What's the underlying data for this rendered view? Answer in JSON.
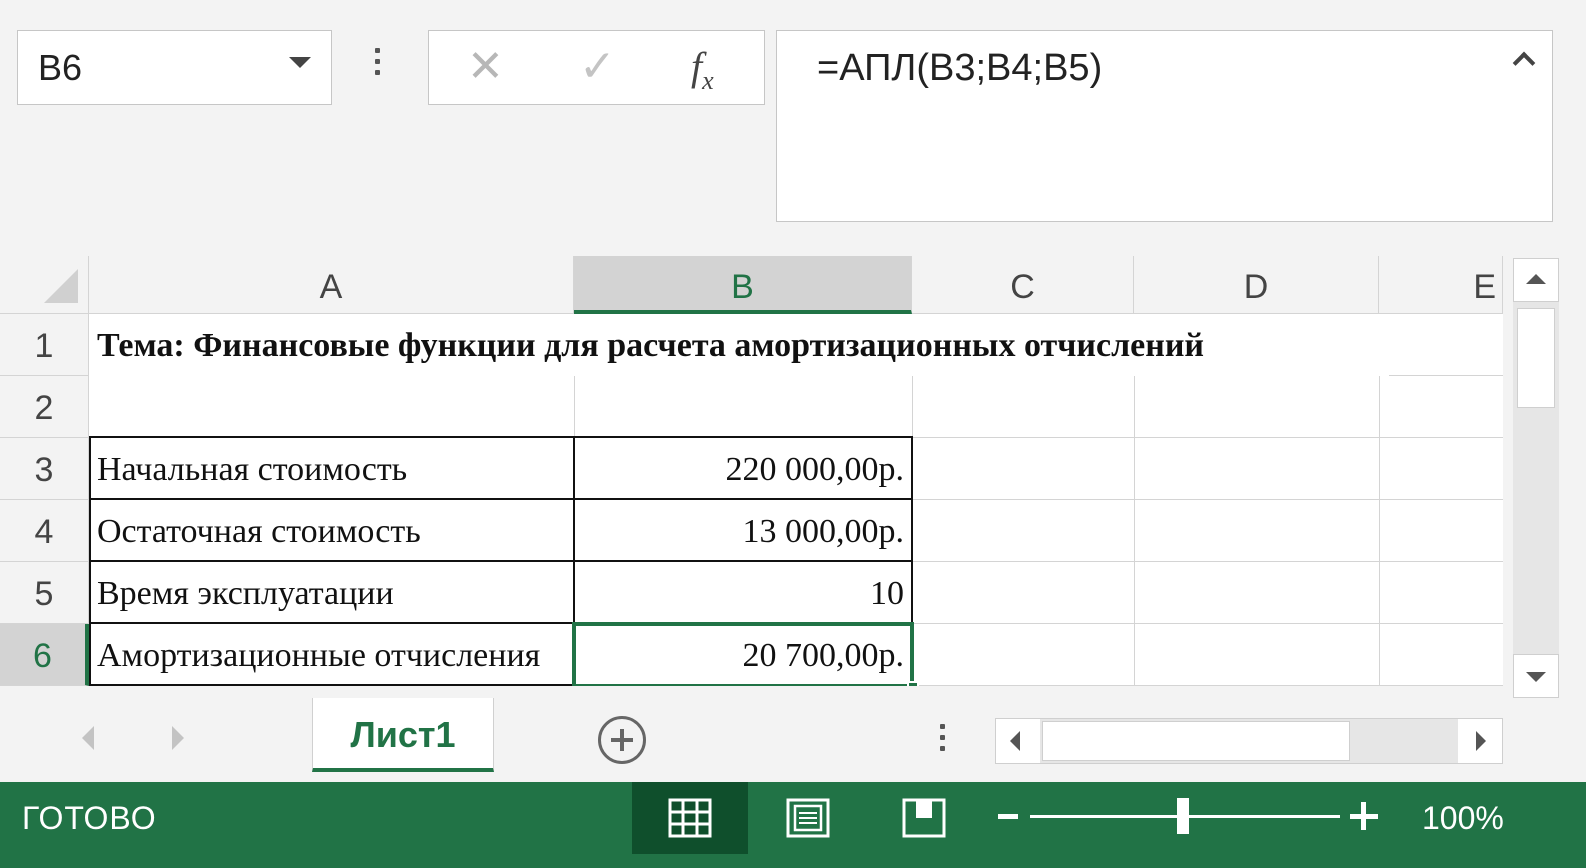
{
  "formula_bar": {
    "name_box": "B6",
    "cancel_glyph": "✕",
    "enter_glyph": "✓",
    "fx_label": "f",
    "fx_sub": "x",
    "formula": "=АПЛ(B3;B4;B5)"
  },
  "grid": {
    "columns": [
      "A",
      "B",
      "C",
      "D",
      "E"
    ],
    "selected_column": "B",
    "rows": [
      "1",
      "2",
      "3",
      "4",
      "5",
      "6"
    ],
    "selected_row": "6",
    "cells": {
      "A1": "Тема: Финансовые функции для расчета амортизационных отчислений",
      "A3": "Начальная стоимость",
      "B3": "220 000,00р.",
      "A4": "Остаточная стоимость",
      "B4": "13 000,00р.",
      "A5": "Время эксплуатации",
      "B5": "10",
      "A6": "Амортизационные отчисления",
      "B6": "20 700,00р."
    }
  },
  "sheet_tabs": {
    "active": "Лист1"
  },
  "status_bar": {
    "status": "ГОТОВО",
    "zoom": "100%"
  },
  "colors": {
    "accent": "#217346",
    "accent_dark": "#0f4f2c"
  },
  "icons": [
    "chevron-down-icon",
    "more-vertical-icon",
    "cancel-icon",
    "enter-icon",
    "function-icon",
    "collapse-icon",
    "select-all-icon",
    "scroll-up-icon",
    "scroll-down-icon",
    "scroll-left-icon",
    "scroll-right-icon",
    "add-sheet-icon",
    "normal-view-icon",
    "page-layout-icon",
    "page-break-icon"
  ]
}
